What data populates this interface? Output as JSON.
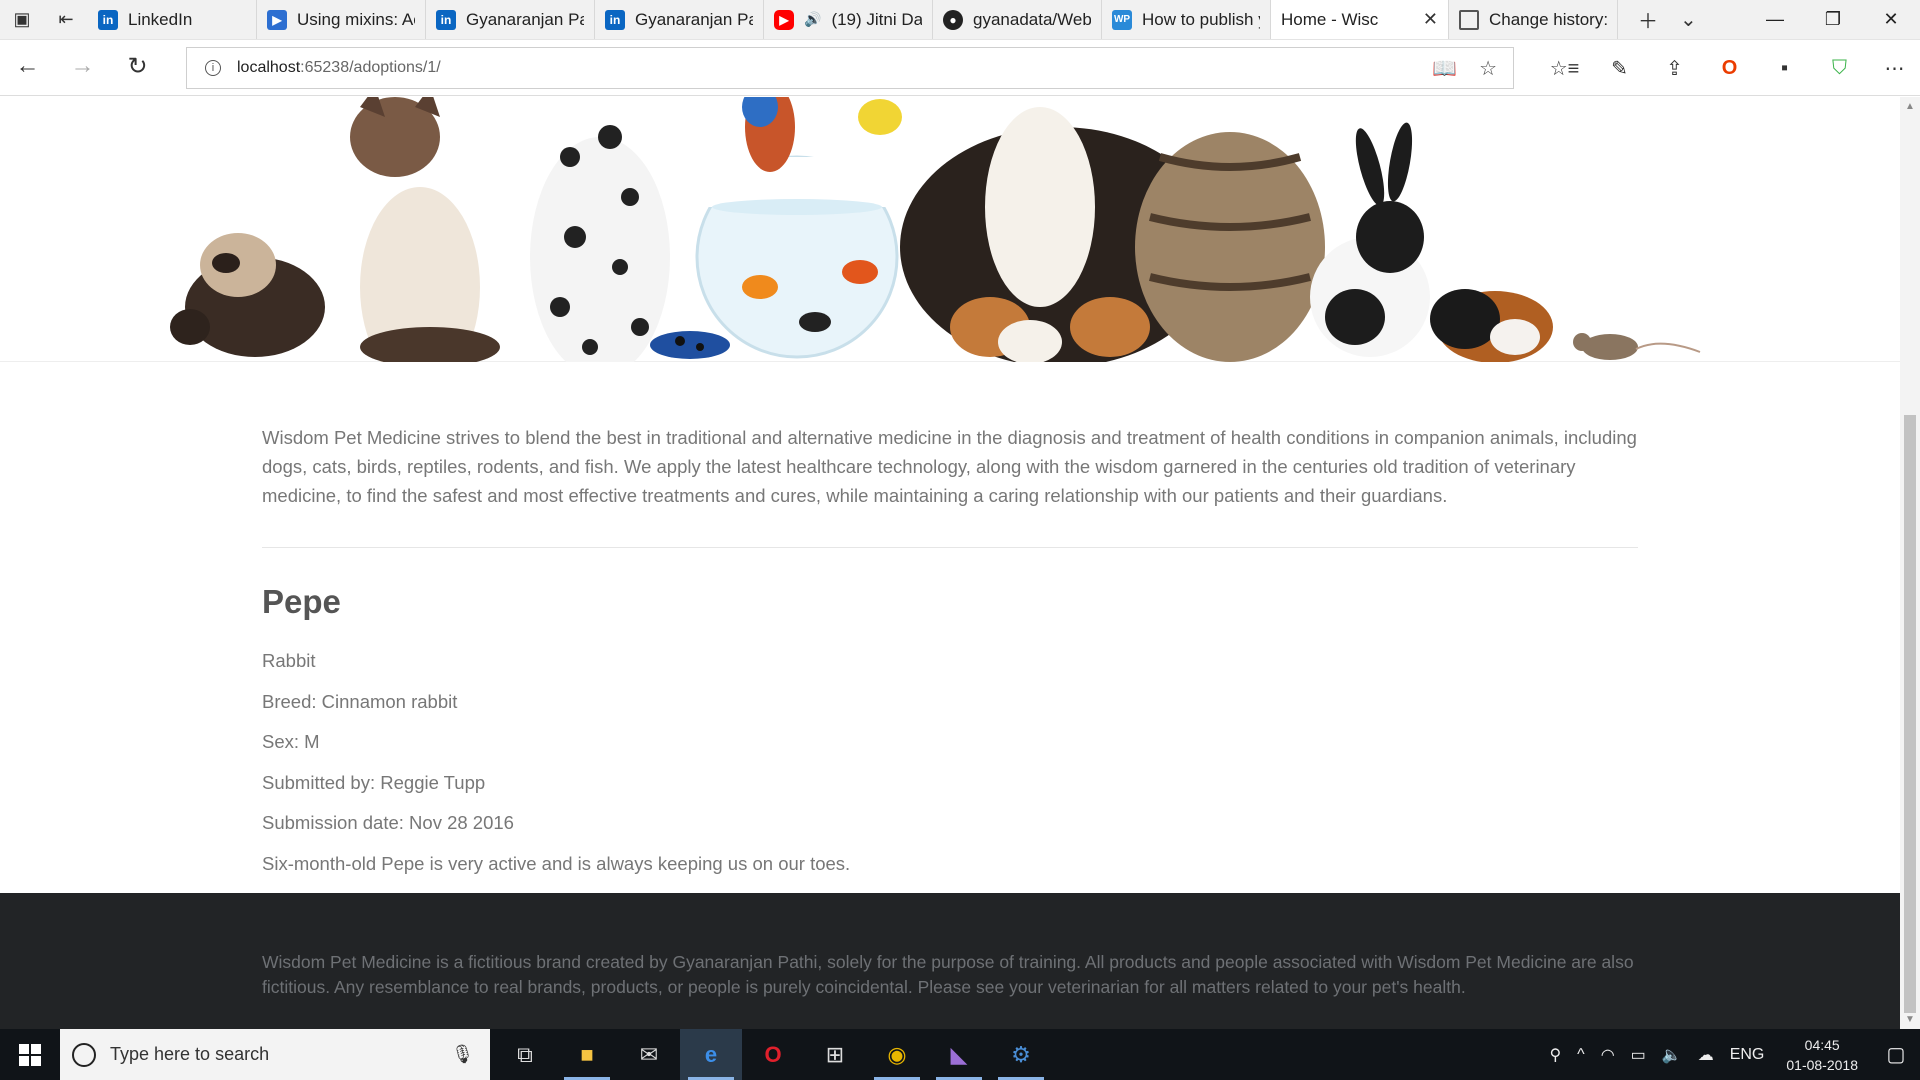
{
  "browser": {
    "tabs": [
      {
        "title": "LinkedIn",
        "icon": "linkedin-icon",
        "fav": "li",
        "glyph": "in"
      },
      {
        "title": "Using mixins: Ac",
        "icon": "video-icon",
        "fav": "vid",
        "glyph": "▶"
      },
      {
        "title": "Gyanaranjan Pat",
        "icon": "linkedin-icon",
        "fav": "li",
        "glyph": "in"
      },
      {
        "title": "Gyanaranjan Pat",
        "icon": "linkedin-icon",
        "fav": "li",
        "glyph": "in"
      },
      {
        "title": "(19) Jitni Da",
        "icon": "youtube-icon",
        "fav": "yt",
        "glyph": "▶",
        "audio": true
      },
      {
        "title": "gyanadata/Web",
        "icon": "github-icon",
        "fav": "gh",
        "glyph": "●"
      },
      {
        "title": "How to publish y",
        "icon": "wordpress-icon",
        "fav": "wp",
        "glyph": "WP"
      },
      {
        "title": "Home - Wisc",
        "icon": "",
        "fav": "",
        "glyph": "",
        "active": true
      },
      {
        "title": "Change history:",
        "icon": "page-icon",
        "fav": "doc",
        "glyph": ""
      }
    ],
    "url_host": "localhost",
    "url_rest": ":65238/adoptions/1/"
  },
  "page": {
    "intro": "Wisdom Pet Medicine strives to blend the best in traditional and alternative medicine in the diagnosis and treatment of health conditions in companion animals, including dogs, cats, birds, reptiles, rodents, and fish. We apply the latest healthcare technology, along with the wisdom garnered in the centuries old tradition of veterinary medicine, to find the safest and most effective treatments and cures, while maintaining a caring relationship with our patients and their guardians.",
    "pet": {
      "name": "Pepe",
      "species": "Rabbit",
      "breed": "Breed: Cinnamon rabbit",
      "sex": "Sex: M",
      "submitter": "Submitted by: Reggie Tupp",
      "date": "Submission date: Nov 28 2016",
      "description": "Six-month-old Pepe is very active and is always keeping us on our toes."
    },
    "footer": "Wisdom Pet Medicine is a fictitious brand created by Gyanaranjan Pathi, solely for the purpose of training. All products and people associated with Wisdom Pet Medicine are also fictitious. Any resemblance to real brands, products, or people is purely coincidental. Please see your veterinarian for all matters related to your pet's health."
  },
  "taskbar": {
    "search_placeholder": "Type here to search",
    "language": "ENG",
    "time": "04:45",
    "date": "01-08-2018"
  }
}
